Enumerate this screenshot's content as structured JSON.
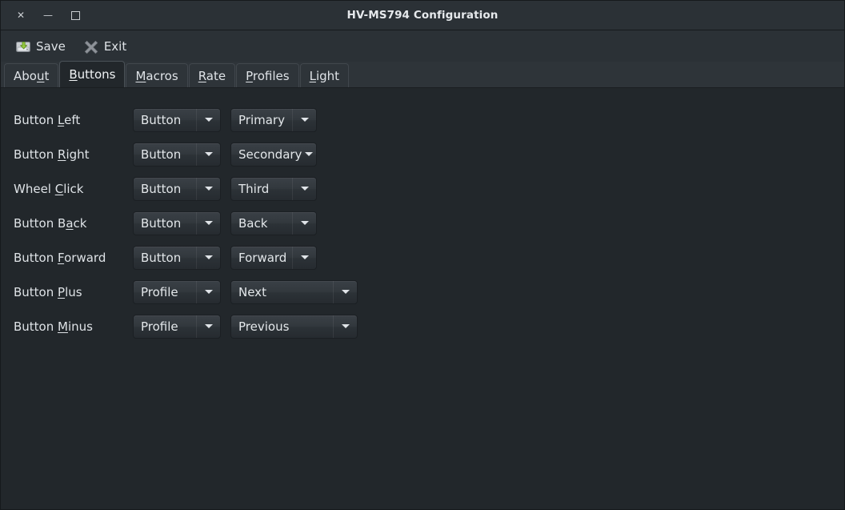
{
  "window": {
    "title": "HV-MS794 Configuration",
    "controls": [
      {
        "name": "close",
        "glyph": "✕"
      },
      {
        "name": "minimize",
        "glyph": "—"
      },
      {
        "name": "maximize",
        "glyph": "□"
      }
    ]
  },
  "toolbar": {
    "save_label": "Save",
    "save_icon": "save-disk-icon",
    "exit_label": "Exit",
    "exit_icon": "close-x-icon"
  },
  "tabs": [
    {
      "label": "About",
      "pre": "Abo",
      "mnemonic": "u",
      "post": "t",
      "active": false
    },
    {
      "label": "Buttons",
      "pre": "",
      "mnemonic": "B",
      "post": "uttons",
      "active": true
    },
    {
      "label": "Macros",
      "pre": "",
      "mnemonic": "M",
      "post": "acros",
      "active": false
    },
    {
      "label": "Rate",
      "pre": "",
      "mnemonic": "R",
      "post": "ate",
      "active": false
    },
    {
      "label": "Profiles",
      "pre": "",
      "mnemonic": "P",
      "post": "rofiles",
      "active": false
    },
    {
      "label": "Light",
      "pre": "",
      "mnemonic": "L",
      "post": "ight",
      "active": false
    }
  ],
  "buttons_tab": {
    "rows": [
      {
        "label": "Button Left",
        "pre": "Button ",
        "mnemonic": "L",
        "post": "eft",
        "action": "Button",
        "value": "Primary",
        "wide": false,
        "tight": false
      },
      {
        "label": "Button Right",
        "pre": "Button ",
        "mnemonic": "R",
        "post": "ight",
        "action": "Button",
        "value": "Secondary",
        "wide": false,
        "tight": true
      },
      {
        "label": "Wheel Click",
        "pre": "Wheel ",
        "mnemonic": "C",
        "post": "lick",
        "action": "Button",
        "value": "Third",
        "wide": false,
        "tight": false
      },
      {
        "label": "Button Back",
        "pre": "Button B",
        "mnemonic": "a",
        "post": "ck",
        "action": "Button",
        "value": "Back",
        "wide": false,
        "tight": false
      },
      {
        "label": "Button Forward",
        "pre": "Button ",
        "mnemonic": "F",
        "post": "orward",
        "action": "Button",
        "value": "Forward",
        "wide": false,
        "tight": false
      },
      {
        "label": "Button Plus",
        "pre": "Button ",
        "mnemonic": "P",
        "post": "lus",
        "action": "Profile",
        "value": "Next",
        "wide": true,
        "tight": false
      },
      {
        "label": "Button Minus",
        "pre": "Button ",
        "mnemonic": "M",
        "post": "inus",
        "action": "Profile",
        "value": "Previous",
        "wide": true,
        "tight": false
      }
    ]
  },
  "colors": {
    "window_bg": "#22272b",
    "chrome_bg": "#2b3136",
    "tabstrip_bg": "#2e3439",
    "text": "#dfe3e7",
    "combo_border": "#1b1f23",
    "save_arrow_green": "#93c83e"
  }
}
